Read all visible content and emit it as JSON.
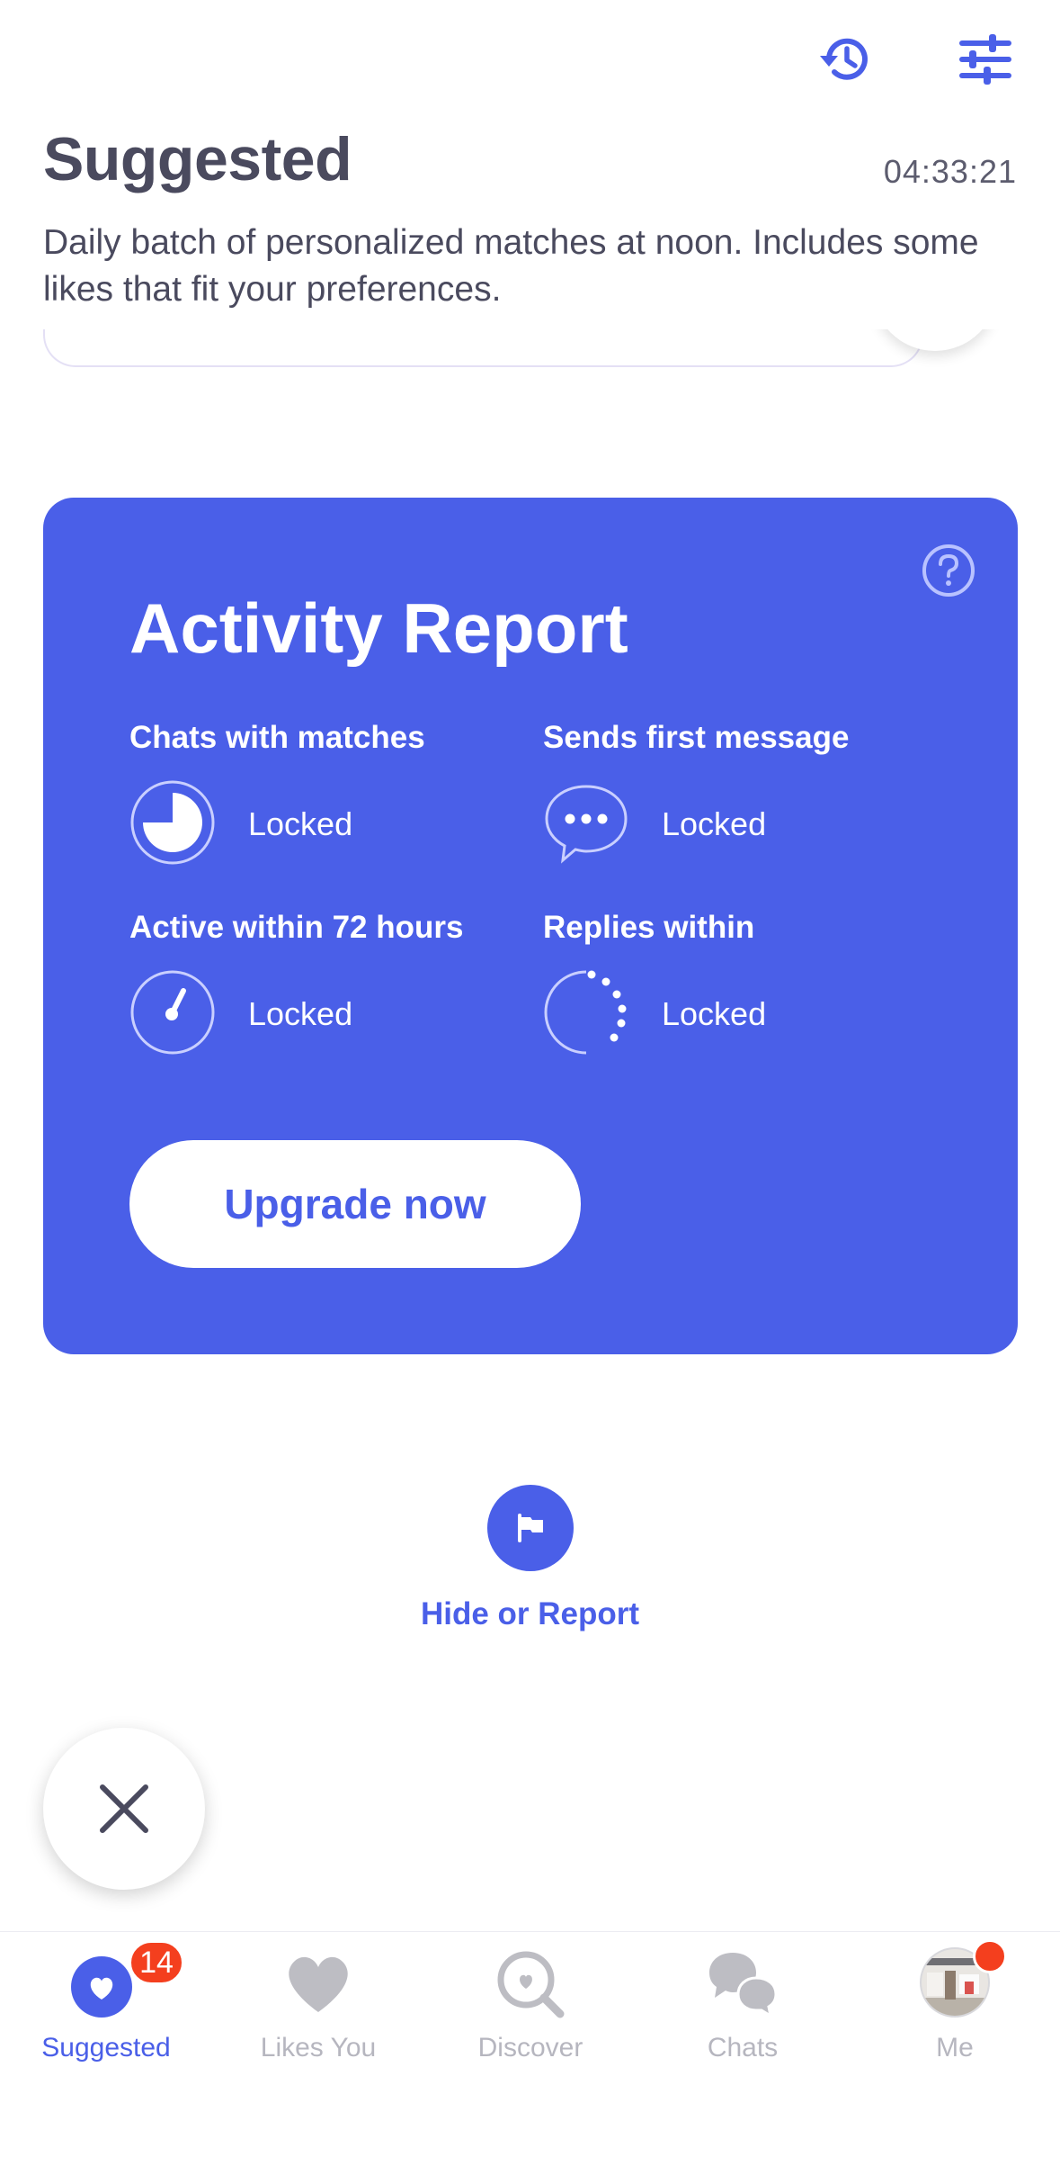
{
  "header": {
    "title": "Suggested",
    "timer": "04:33:21",
    "subtitle": "Daily batch of personalized matches at noon. Includes some likes that fit your preferences.",
    "icons": [
      "history-icon",
      "filter-sliders-icon"
    ]
  },
  "activity_report": {
    "title": "Activity Report",
    "help_icon": "question-circle-icon",
    "stats": [
      {
        "label": "Chats with matches",
        "value": "Locked",
        "icon": "pie-chart-icon"
      },
      {
        "label": "Sends first message",
        "value": "Locked",
        "icon": "speech-bubble-icon"
      },
      {
        "label": "Active within 72 hours",
        "value": "Locked",
        "icon": "clock-gauge-icon"
      },
      {
        "label": "Replies within",
        "value": "Locked",
        "icon": "dotted-timer-icon"
      }
    ],
    "upgrade_label": "Upgrade now"
  },
  "hide_report": {
    "label": "Hide or Report",
    "icon": "flag-icon"
  },
  "close_button": {
    "icon": "close-icon"
  },
  "tabbar": {
    "tabs": [
      {
        "label": "Suggested",
        "badge": "14",
        "active": true,
        "icon": "heart-circle-icon"
      },
      {
        "label": "Likes You",
        "icon": "heart-icon"
      },
      {
        "label": "Discover",
        "icon": "discover-search-icon"
      },
      {
        "label": "Chats",
        "icon": "chat-bubbles-icon"
      },
      {
        "label": "Me",
        "icon": "avatar",
        "dot": true
      }
    ]
  },
  "colors": {
    "accent": "#4a5fe8",
    "badge": "#f43f1e",
    "text": "#4a4a5e",
    "inactive": "#b6b6bf"
  }
}
